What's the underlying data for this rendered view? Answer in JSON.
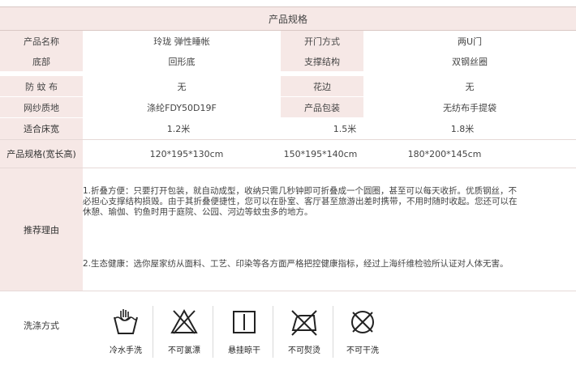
{
  "title": "产品规格",
  "specs": [
    {
      "label1": "产品名称",
      "value1": "玲珑 弹性睡帐",
      "label2": "开门方式",
      "value2": "两U门"
    },
    {
      "label1": "底部",
      "value1": "回形底",
      "label2": "支撑结构",
      "value2": "双钢丝圈"
    },
    {
      "label1": "防 蚊 布",
      "value1": "无",
      "label2": "花边",
      "value2": "无"
    },
    {
      "label1": "网纱质地",
      "value1": "涤纶FDY50D19F",
      "label2": "产品包装",
      "value2": "无纺布手提袋"
    }
  ],
  "bed": {
    "label": "适合床宽",
    "values": [
      "1.2米",
      "1.5米",
      "1.8米"
    ]
  },
  "size": {
    "label": "产品规格(宽长高)",
    "values": [
      "120*195*130cm",
      "150*195*140cm",
      "180*200*145cm"
    ]
  },
  "reason": {
    "label": "推荐理由",
    "p1": "1.折叠方便：只要打开包装，就自动成型，收纳只需几秒钟即可折叠成一个圆圈，甚至可以每天收折。优质钢丝，不必担心支撑结构损毁。由于其折叠便捷性，您可以在卧室、客厅甚至旅游出差时携带，不用时随时收起。您还可以在休憩、瑜伽、钓鱼时用于庭院、公园、河边等蚊虫多的地方。",
    "p2": "2.生态健康：选你屋家纺从面料、工艺、印染等各方面严格把控健康指标，经过上海纤维检验所认证对人体无害。"
  },
  "wash": {
    "label": "洗涤方式",
    "items": [
      {
        "icon": "hand-wash-icon",
        "caption": "冷水手洗"
      },
      {
        "icon": "no-bleach-icon",
        "caption": "不可氯漂"
      },
      {
        "icon": "hang-dry-icon",
        "caption": "悬挂晾干"
      },
      {
        "icon": "no-iron-icon",
        "caption": "不可熨烫"
      },
      {
        "icon": "no-dry-clean-icon",
        "caption": "不可干洗"
      }
    ]
  }
}
